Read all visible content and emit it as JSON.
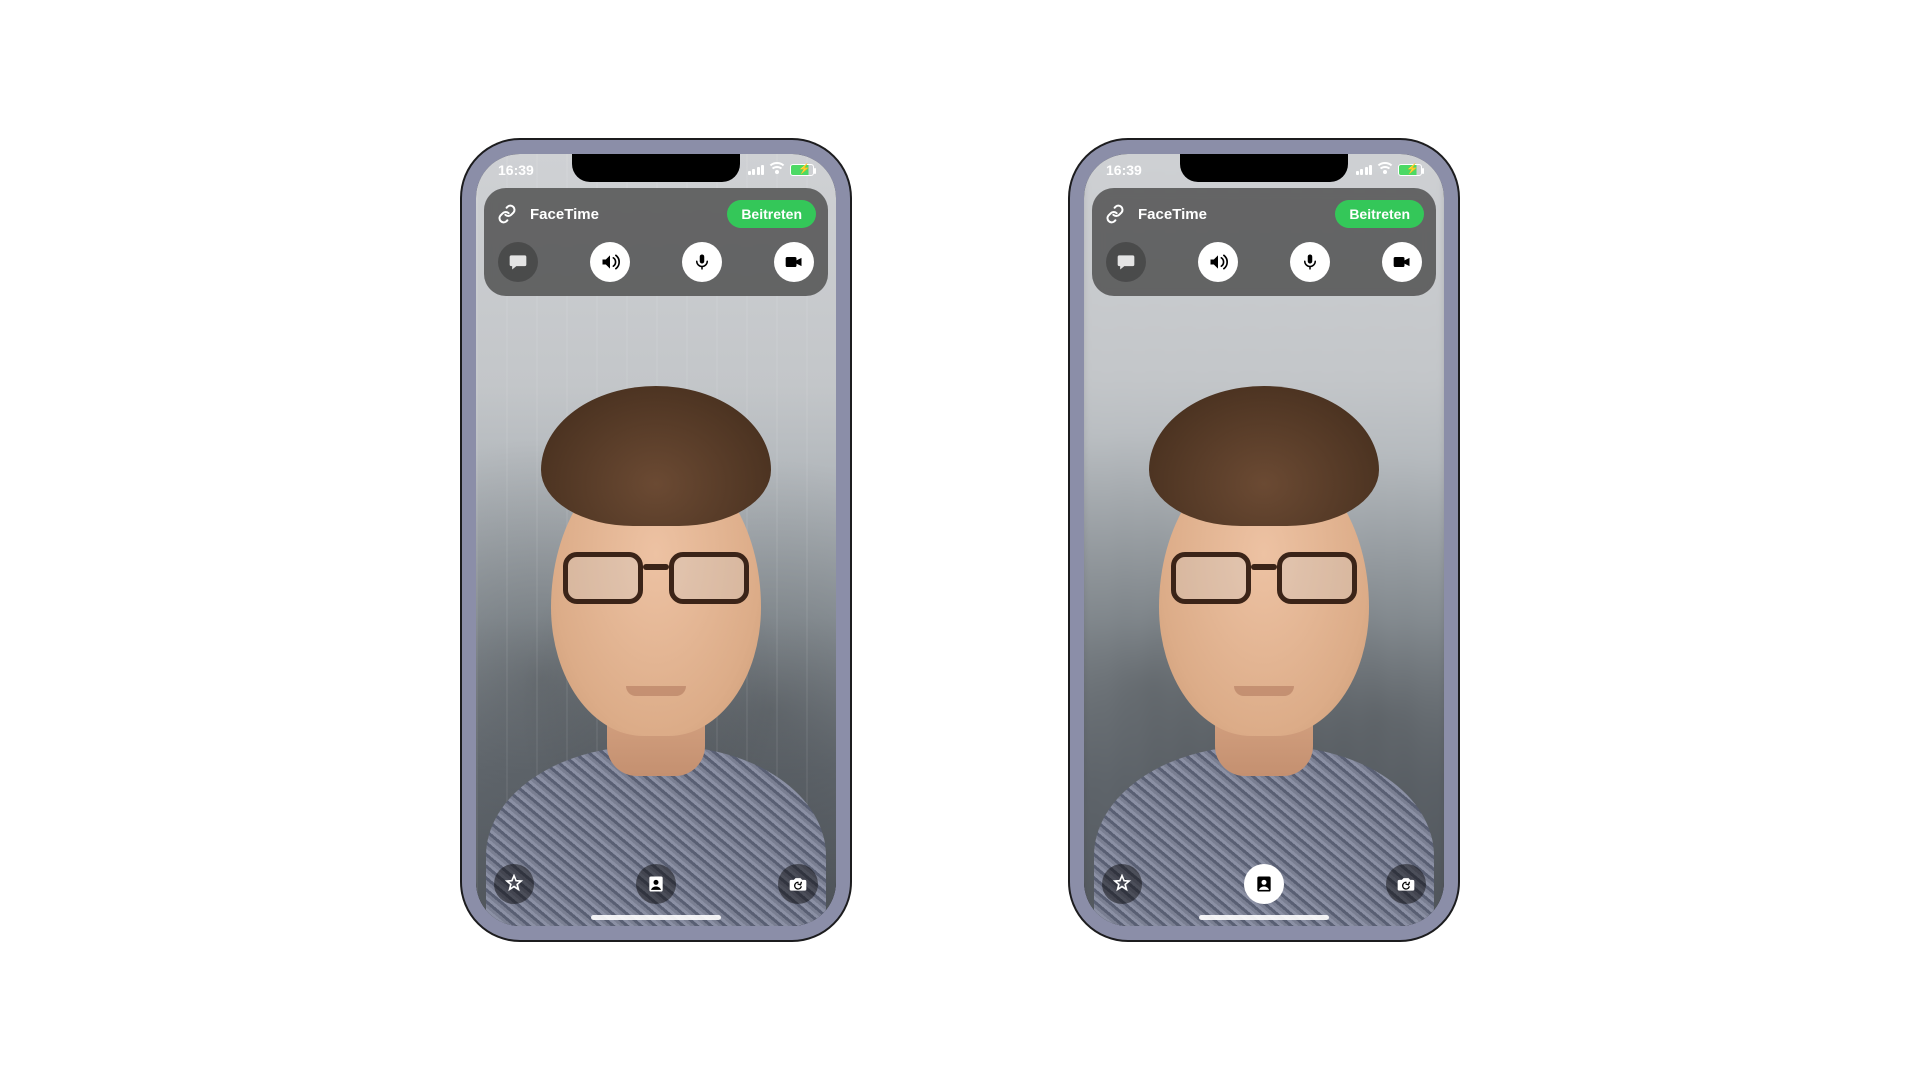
{
  "phones": [
    {
      "status": {
        "time": "16:39"
      },
      "panel": {
        "app_label": "FaceTime",
        "join_label": "Beitreten",
        "icons": {
          "link": "link-icon",
          "chat": "chat-bubble-icon",
          "speaker": "speaker-icon",
          "mic": "microphone-icon",
          "video": "video-camera-icon"
        }
      },
      "bottom": {
        "icons": {
          "effects": "star-effects-icon",
          "portrait": "portrait-person-icon",
          "flip": "camera-flip-icon"
        },
        "portrait_active": false
      },
      "background_blurred": false
    },
    {
      "status": {
        "time": "16:39"
      },
      "panel": {
        "app_label": "FaceTime",
        "join_label": "Beitreten",
        "icons": {
          "link": "link-icon",
          "chat": "chat-bubble-icon",
          "speaker": "speaker-icon",
          "mic": "microphone-icon",
          "video": "video-camera-icon"
        }
      },
      "bottom": {
        "icons": {
          "effects": "star-effects-icon",
          "portrait": "portrait-person-icon",
          "flip": "camera-flip-icon"
        },
        "portrait_active": true
      },
      "background_blurred": true
    }
  ],
  "colors": {
    "accent": "#34c759",
    "panel": "rgba(70,70,70,0.78)"
  }
}
